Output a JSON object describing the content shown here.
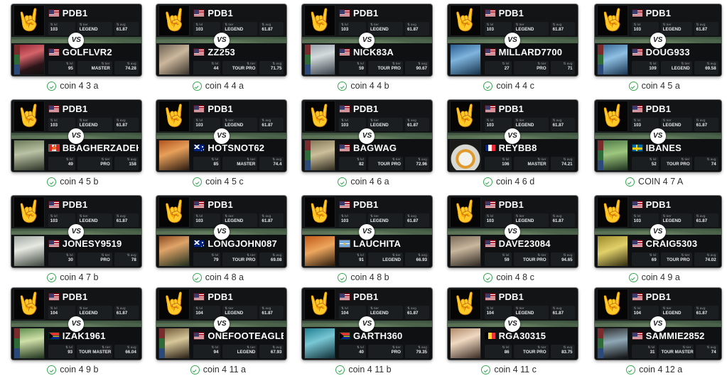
{
  "meta": {
    "vs_label": "VS",
    "stat_labels": {
      "lvl": "lvl",
      "tier": "tier",
      "avg": "avg"
    },
    "sort_arrow": "⇅",
    "check_icon": "check-circle-icon",
    "skull_glyph": "🤘",
    "leaf_glyph": "🍁",
    "colors": {
      "check_green": "#36a852",
      "card_bg": "#0b0c0d",
      "panel_bg": "#121416",
      "vs_bg": "#ffffff",
      "caption_text": "#2f2f2f"
    }
  },
  "cards": [
    {
      "caption": "coin 4 3 a",
      "top": {
        "name": "PDB1",
        "flag": "us",
        "lvl": "103",
        "tier": "LEGEND",
        "avg": "61.87",
        "avatar": "skull"
      },
      "bottom": {
        "name": "GOLFLVR2",
        "flag": "us",
        "lvl": "95",
        "tier": "MASTER",
        "avg": "74.28",
        "avatar": "photo-red"
      }
    },
    {
      "caption": "coin 4 4 a",
      "top": {
        "name": "PDB1",
        "flag": "us",
        "lvl": "103",
        "tier": "LEGEND",
        "avg": "61.87",
        "avatar": "skull"
      },
      "bottom": {
        "name": "ZZ253",
        "flag": "us",
        "lvl": "44",
        "tier": "TOUR PRO",
        "avg": "71.75",
        "avatar": "photo-couple"
      }
    },
    {
      "caption": "coin 4 4 b",
      "top": {
        "name": "PDB1",
        "flag": "us",
        "lvl": "103",
        "tier": "LEGEND",
        "avg": "61.87",
        "avatar": "skull"
      },
      "bottom": {
        "name": "NICK83A",
        "flag": "us",
        "lvl": "59",
        "tier": "TOUR PRO",
        "avg": "90.67",
        "avatar": "photo-golfer-grey"
      }
    },
    {
      "caption": "coin 4 4 c",
      "top": {
        "name": "PDB1",
        "flag": "us",
        "lvl": "103",
        "tier": "LEGEND",
        "avg": "61.87",
        "avatar": "skull"
      },
      "bottom": {
        "name": "MILLARD7700",
        "flag": "us",
        "lvl": "27",
        "tier": "PRO",
        "avg": "71",
        "avatar": "photo-blue"
      }
    },
    {
      "caption": "coin 4 5 a",
      "top": {
        "name": "PDB1",
        "flag": "us",
        "lvl": "103",
        "tier": "LEGEND",
        "avg": "61.87",
        "avatar": "skull"
      },
      "bottom": {
        "name": "DOUG933",
        "flag": "us",
        "lvl": "109",
        "tier": "LEGEND",
        "avg": "69.58",
        "avatar": "photo-cap-blue"
      }
    },
    {
      "caption": "coin 4 5 b",
      "top": {
        "name": "PDB1",
        "flag": "us",
        "lvl": "103",
        "tier": "LEGEND",
        "avg": "61.87",
        "avatar": "skull"
      },
      "bottom": {
        "name": "BBAGHERZADEH",
        "flag": "ca",
        "lvl": "49",
        "tier": "PRO",
        "avg": "158",
        "avatar": "photo-man-field"
      }
    },
    {
      "caption": "coin 4 5 c",
      "top": {
        "name": "PDB1",
        "flag": "us",
        "lvl": "103",
        "tier": "LEGEND",
        "avg": "61.87",
        "avatar": "skull"
      },
      "bottom": {
        "name": "HOTSNOT62",
        "flag": "au",
        "lvl": "85",
        "tier": "MASTER",
        "avg": "74.4",
        "avatar": "photo-orange-cap"
      }
    },
    {
      "caption": "coin 4 6 a",
      "top": {
        "name": "PDB1",
        "flag": "us",
        "lvl": "103",
        "tier": "LEGEND",
        "avg": "61.87",
        "avatar": "skull"
      },
      "bottom": {
        "name": "BAGWAG",
        "flag": "us",
        "lvl": "82",
        "tier": "TOUR PRO",
        "avg": "72.96",
        "avatar": "photo-cap-tan"
      }
    },
    {
      "caption": "coin 4 6 d",
      "top": {
        "name": "PDB1",
        "flag": "us",
        "lvl": "103",
        "tier": "LEGEND",
        "avg": "61.87",
        "avatar": "skull"
      },
      "bottom": {
        "name": "REYBB8",
        "flag": "fr",
        "lvl": "106",
        "tier": "MASTER",
        "avg": "74.21",
        "avatar": "photo-droid"
      }
    },
    {
      "caption": "COIN 4 7 A",
      "top": {
        "name": "PDB1",
        "flag": "us",
        "lvl": "103",
        "tier": "LEGEND",
        "avg": "61.87",
        "avatar": "skull"
      },
      "bottom": {
        "name": "IBANES",
        "flag": "se",
        "lvl": "52",
        "tier": "TOUR PRO",
        "avg": "74",
        "avatar": "photo-green-field"
      }
    },
    {
      "caption": "coin 4 7 b",
      "top": {
        "name": "PDB1",
        "flag": "us",
        "lvl": "103",
        "tier": "LEGEND",
        "avg": "61.87",
        "avatar": "skull"
      },
      "bottom": {
        "name": "JONESY9519",
        "flag": "us",
        "lvl": "30",
        "tier": "PRO",
        "avg": "78",
        "avatar": "photo-golfer-white"
      }
    },
    {
      "caption": "coin 4 8 a",
      "top": {
        "name": "PDB1",
        "flag": "us",
        "lvl": "103",
        "tier": "LEGEND",
        "avg": "61.87",
        "avatar": "skull"
      },
      "bottom": {
        "name": "LONGJOHN087",
        "flag": "au",
        "lvl": "79",
        "tier": "TOUR PRO",
        "avg": "69.08",
        "avatar": "photo-red-hair"
      }
    },
    {
      "caption": "coin 4 8 b",
      "top": {
        "name": "PDB1",
        "flag": "us",
        "lvl": "103",
        "tier": "LEGEND",
        "avg": "61.87",
        "avatar": "skull"
      },
      "bottom": {
        "name": "LAUCHITA",
        "flag": "ar",
        "lvl": "91",
        "tier": "LEGEND",
        "avg": "66.93",
        "avatar": "photo-orange-shirt"
      }
    },
    {
      "caption": "coin 4 8 c",
      "top": {
        "name": "PDB1",
        "flag": "us",
        "lvl": "103",
        "tier": "LEGEND",
        "avg": "61.87",
        "avatar": "skull"
      },
      "bottom": {
        "name": "DAVE23084",
        "flag": "us",
        "lvl": "59",
        "tier": "TOUR PRO",
        "avg": "94.65",
        "avatar": "photo-beard"
      }
    },
    {
      "caption": "coin 4 9 a",
      "top": {
        "name": "PDB1",
        "flag": "us",
        "lvl": "103",
        "tier": "LEGEND",
        "avg": "61.87",
        "avatar": "skull"
      },
      "bottom": {
        "name": "CRAIG5303",
        "flag": "us",
        "lvl": "69",
        "tier": "TOUR PRO",
        "avg": "74.02",
        "avatar": "photo-yellow"
      }
    },
    {
      "caption": "coin 4 9 b",
      "top": {
        "name": "PDB1",
        "flag": "us",
        "lvl": "104",
        "tier": "LEGEND",
        "avg": "61.87",
        "avatar": "skull"
      },
      "bottom": {
        "name": "IZAK1961",
        "flag": "za",
        "lvl": "93",
        "tier": "TOUR MASTER",
        "avg": "66.04",
        "avatar": "photo-green-course"
      }
    },
    {
      "caption": "coin 4 11 a",
      "top": {
        "name": "PDB1",
        "flag": "us",
        "lvl": "104",
        "tier": "LEGEND",
        "avg": "61.87",
        "avatar": "skull"
      },
      "bottom": {
        "name": "ONEFOOTEAGLE",
        "flag": "us",
        "lvl": "94",
        "tier": "LEGEND",
        "avg": "67.93",
        "avatar": "photo-trophy"
      }
    },
    {
      "caption": "coin 4 11 b",
      "top": {
        "name": "PDB1",
        "flag": "us",
        "lvl": "104",
        "tier": "LEGEND",
        "avg": "61.87",
        "avatar": "skull"
      },
      "bottom": {
        "name": "GARTH360",
        "flag": "za",
        "lvl": "40",
        "tier": "PRO",
        "avg": "79.35",
        "avatar": "photo-teal"
      }
    },
    {
      "caption": "coin 4 11 c",
      "top": {
        "name": "PDB1",
        "flag": "us",
        "lvl": "104",
        "tier": "LEGEND",
        "avg": "61.87",
        "avatar": "skull"
      },
      "bottom": {
        "name": "RGA30315",
        "flag": "be",
        "lvl": "86",
        "tier": "TOUR PRO",
        "avg": "83.75",
        "avatar": "photo-woman"
      }
    },
    {
      "caption": "coin 4 12 a",
      "top": {
        "name": "PDB1",
        "flag": "us",
        "lvl": "104",
        "tier": "LEGEND",
        "avg": "61.87",
        "avatar": "skull"
      },
      "bottom": {
        "name": "SAMMIE2852",
        "flag": "us",
        "lvl": "31",
        "tier": "TOUR MASTER",
        "avg": "74",
        "avatar": "photo-dog"
      }
    }
  ]
}
